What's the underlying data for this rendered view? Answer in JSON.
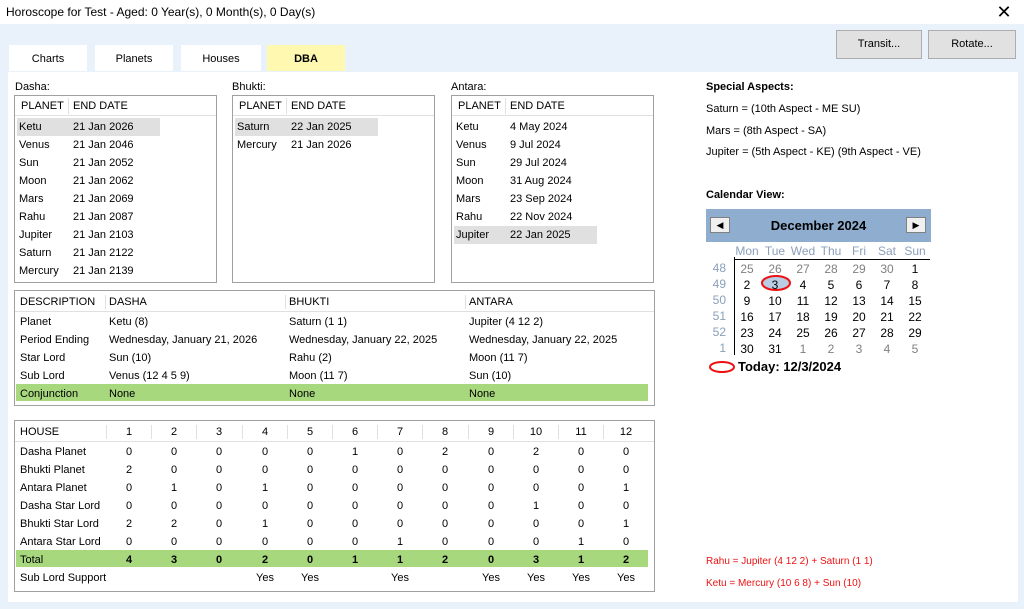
{
  "window": {
    "title": "Horoscope for Test - Aged: 0 Year(s), 0 Month(s), 0 Day(s)",
    "close": "✕"
  },
  "tabs": [
    "Charts",
    "Planets",
    "Houses",
    "DBA"
  ],
  "buttons": {
    "transit": "Transit...",
    "rotate": "Rotate..."
  },
  "dasha": {
    "label": "Dasha:",
    "headers": [
      "PLANET",
      "END DATE"
    ],
    "rows": [
      [
        "Ketu",
        "21 Jan 2026"
      ],
      [
        "Venus",
        "21 Jan 2046"
      ],
      [
        "Sun",
        "21 Jan 2052"
      ],
      [
        "Moon",
        "21 Jan 2062"
      ],
      [
        "Mars",
        "21 Jan 2069"
      ],
      [
        "Rahu",
        "21 Jan 2087"
      ],
      [
        "Jupiter",
        "21 Jan 2103"
      ],
      [
        "Saturn",
        "21 Jan 2122"
      ],
      [
        "Mercury",
        "21 Jan 2139"
      ]
    ]
  },
  "bhukti": {
    "label": "Bhukti:",
    "headers": [
      "PLANET",
      "END DATE"
    ],
    "rows": [
      [
        "Saturn",
        "22 Jan 2025"
      ],
      [
        "Mercury",
        "21 Jan 2026"
      ]
    ]
  },
  "antara": {
    "label": "Antara:",
    "headers": [
      "PLANET",
      "END DATE"
    ],
    "rows": [
      [
        "Ketu",
        "4 May 2024"
      ],
      [
        "Venus",
        "9 Jul 2024"
      ],
      [
        "Sun",
        "29 Jul 2024"
      ],
      [
        "Moon",
        "31 Aug 2024"
      ],
      [
        "Mars",
        "23 Sep 2024"
      ],
      [
        "Rahu",
        "22 Nov 2024"
      ],
      [
        "Jupiter",
        "22 Jan 2025"
      ]
    ]
  },
  "description": {
    "headers": [
      "DESCRIPTION",
      "DASHA",
      "BHUKTI",
      "ANTARA"
    ],
    "rows": [
      [
        "Planet",
        "Ketu (8)",
        "Saturn (1 1)",
        "Jupiter (4 12 2)"
      ],
      [
        "Period Ending",
        "Wednesday, January 21, 2026",
        "Wednesday, January 22, 2025",
        "Wednesday, January 22, 2025"
      ],
      [
        "Star Lord",
        "Sun (10)",
        "Rahu (2)",
        "Moon (11 7)"
      ],
      [
        "Sub Lord",
        "Venus (12 4 5 9)",
        "Moon (11 7)",
        "Sun (10)"
      ],
      [
        "Conjunction",
        "None",
        "None",
        "None"
      ]
    ]
  },
  "house": {
    "headers": [
      "HOUSE",
      "1",
      "2",
      "3",
      "4",
      "5",
      "6",
      "7",
      "8",
      "9",
      "10",
      "11",
      "12"
    ],
    "rows": [
      [
        "Dasha Planet",
        "0",
        "0",
        "0",
        "0",
        "0",
        "1",
        "0",
        "2",
        "0",
        "2",
        "0",
        "0"
      ],
      [
        "Bhukti Planet",
        "2",
        "0",
        "0",
        "0",
        "0",
        "0",
        "0",
        "0",
        "0",
        "0",
        "0",
        "0"
      ],
      [
        "Antara Planet",
        "0",
        "1",
        "0",
        "1",
        "0",
        "0",
        "0",
        "0",
        "0",
        "0",
        "0",
        "1"
      ],
      [
        "Dasha Star Lord",
        "0",
        "0",
        "0",
        "0",
        "0",
        "0",
        "0",
        "0",
        "0",
        "1",
        "0",
        "0"
      ],
      [
        "Bhukti Star Lord",
        "2",
        "2",
        "0",
        "1",
        "0",
        "0",
        "0",
        "0",
        "0",
        "0",
        "0",
        "1"
      ],
      [
        "Antara Star Lord",
        "0",
        "0",
        "0",
        "0",
        "0",
        "0",
        "1",
        "0",
        "0",
        "0",
        "1",
        "0"
      ],
      [
        "Total",
        "4",
        "3",
        "0",
        "2",
        "0",
        "1",
        "1",
        "2",
        "0",
        "3",
        "1",
        "2"
      ],
      [
        "Sub Lord Support",
        "",
        "",
        "",
        "Yes",
        "Yes",
        "",
        "Yes",
        "",
        "Yes",
        "Yes",
        "Yes",
        "Yes"
      ]
    ]
  },
  "special_aspects": {
    "title": "Special Aspects:",
    "lines": [
      "Saturn = (10th Aspect - ME SU)",
      "Mars = (8th Aspect - SA)",
      "Jupiter = (5th Aspect - KE) (9th Aspect - VE)"
    ]
  },
  "calendar": {
    "title": "Calendar View:",
    "month": "December 2024",
    "prev": "◀",
    "next": "▶",
    "daynames": [
      "Mon",
      "Tue",
      "Wed",
      "Thu",
      "Fri",
      "Sat",
      "Sun"
    ],
    "weeks": [
      "48",
      "49",
      "50",
      "51",
      "52",
      "1"
    ],
    "days": [
      [
        "25",
        "26",
        "27",
        "28",
        "29",
        "30",
        "1"
      ],
      [
        "2",
        "3",
        "4",
        "5",
        "6",
        "7",
        "8"
      ],
      [
        "9",
        "10",
        "11",
        "12",
        "13",
        "14",
        "15"
      ],
      [
        "16",
        "17",
        "18",
        "19",
        "20",
        "21",
        "22"
      ],
      [
        "23",
        "24",
        "25",
        "26",
        "27",
        "28",
        "29"
      ],
      [
        "30",
        "31",
        "1",
        "2",
        "3",
        "4",
        "5"
      ]
    ],
    "today": "Today: 12/3/2024"
  },
  "notes": [
    "Rahu = Jupiter (4 12 2) + Saturn (1 1)",
    "Ketu = Mercury (10 6 8) + Sun (10)"
  ],
  "colors": {
    "accent_green": "#a8d87e",
    "active_tab": "#fff8b0",
    "calendar_header": "#8fadcf",
    "note_red": "#ee1111"
  }
}
